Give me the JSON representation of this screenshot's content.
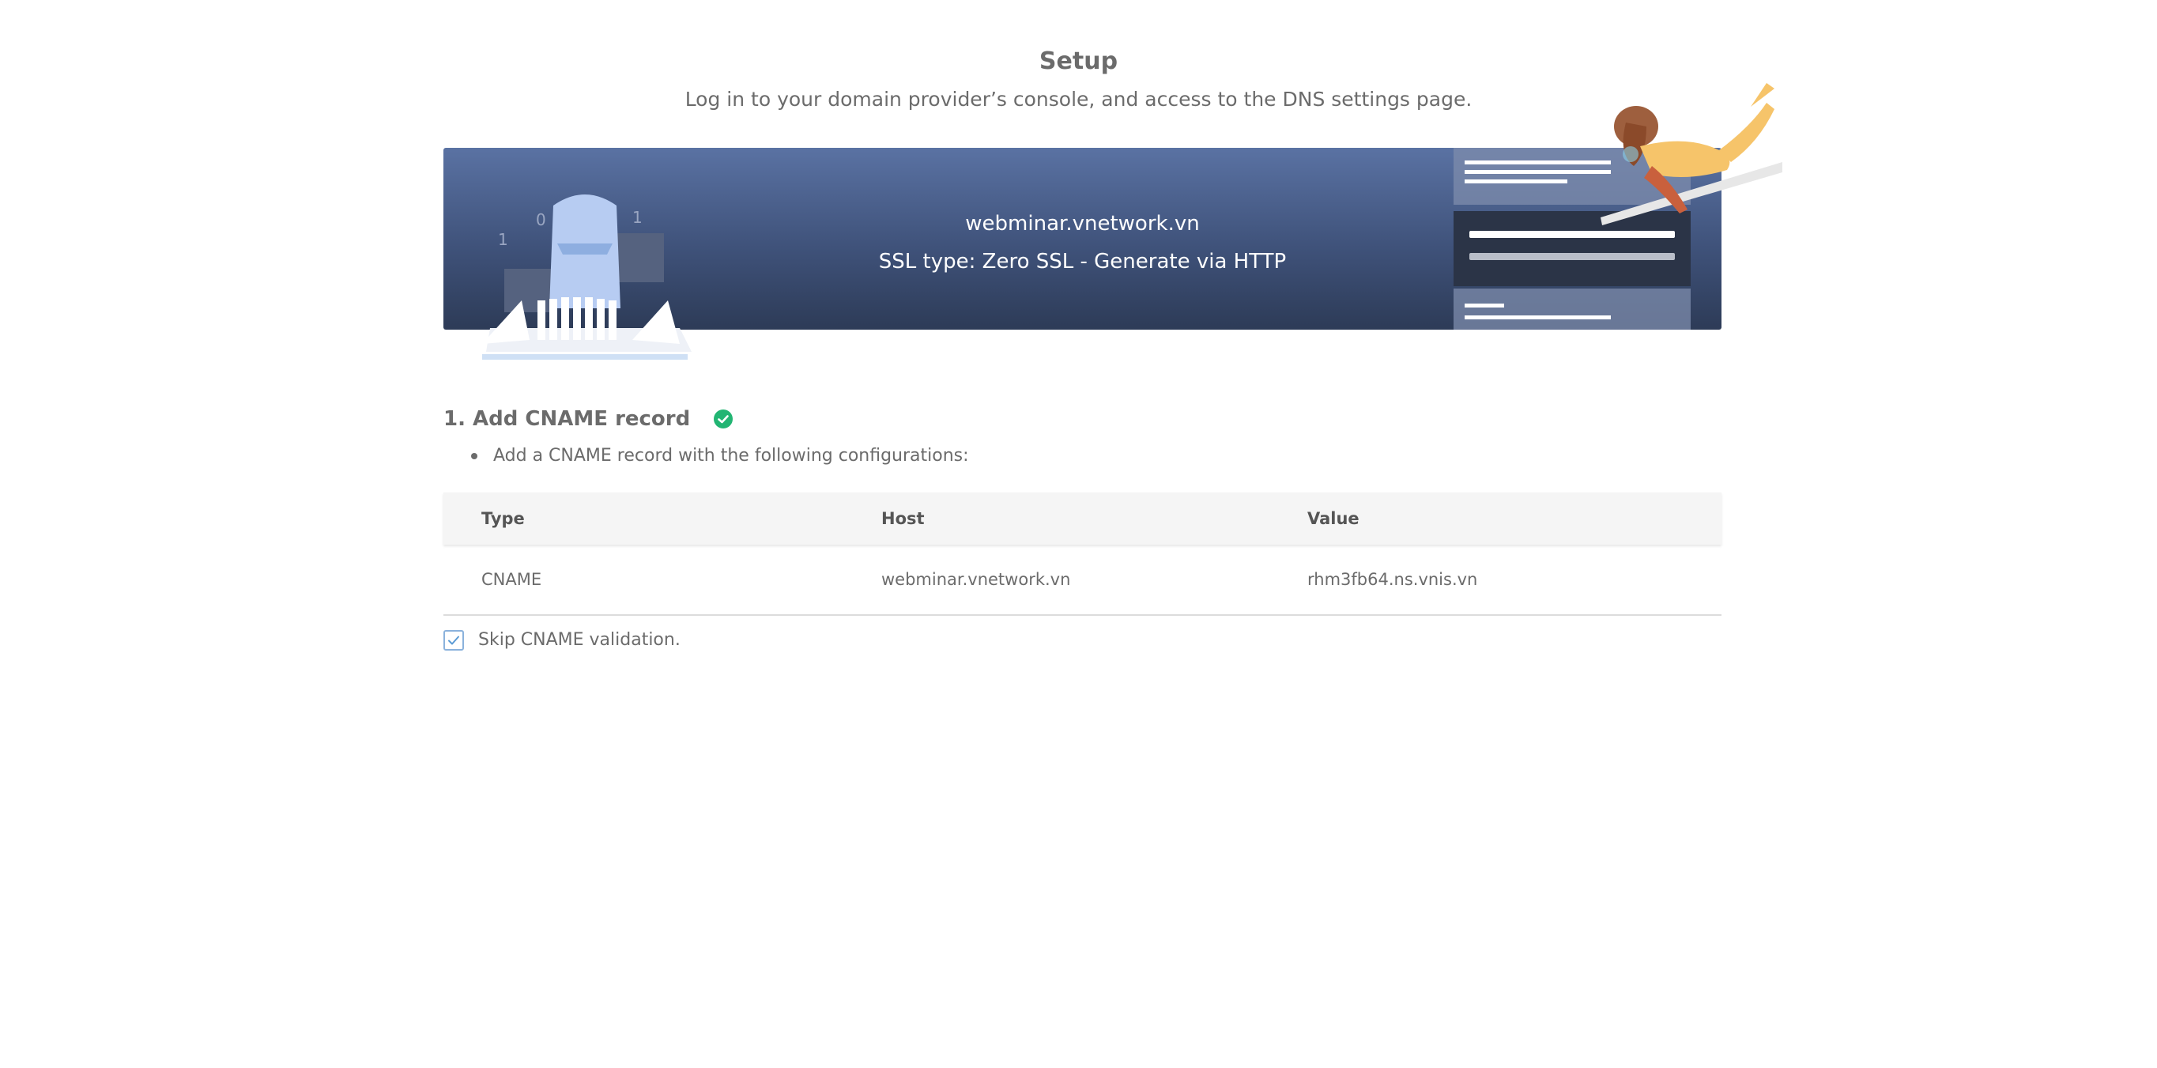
{
  "header": {
    "title": "Setup",
    "subtitle": "Log in to your domain provider’s console, and access to the DNS settings page."
  },
  "banner": {
    "domain": "webminar.vnetwork.vn",
    "ssl_type": "SSL type: Zero SSL - Generate via HTTP"
  },
  "step1": {
    "title": "1. Add CNAME record",
    "status_icon": "check-circle-icon",
    "instruction": "Add a CNAME record with the following configurations:"
  },
  "table": {
    "headers": [
      "Type",
      "Host",
      "Value"
    ],
    "rows": [
      [
        "CNAME",
        "webminar.vnetwork.vn",
        "rhm3fb64.ns.vnis.vn"
      ]
    ]
  },
  "skip_validation": {
    "label": "Skip CNAME validation.",
    "checked": true
  },
  "colors": {
    "banner_top": "#5a72a3",
    "banner_bottom": "#2d3b57",
    "success_green": "#22b573",
    "checkbox_blue": "#8bb2dc",
    "text_gray": "#6b6b6b"
  }
}
